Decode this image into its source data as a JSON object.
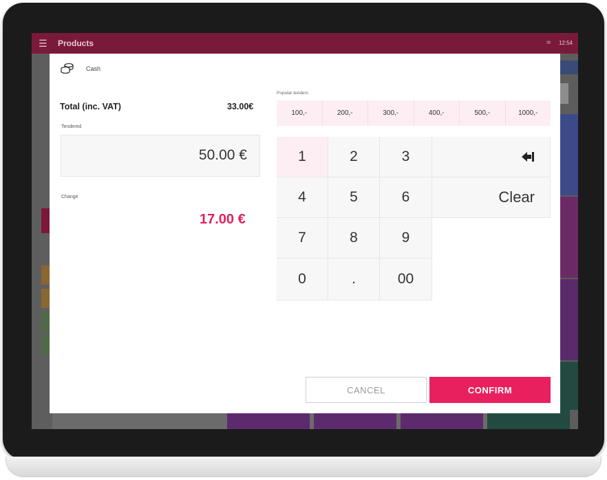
{
  "app": {
    "title": "Products",
    "time": "12:54"
  },
  "modal": {
    "payment_method": "Cash",
    "total_label": "Total (inc. VAT)",
    "total_value": "33.00€",
    "tendered_label": "Tendered",
    "tendered_value": "50.00 €",
    "change_label": "Change",
    "change_value": "17.00 €",
    "popular_label": "Popular tenders",
    "tenders": [
      "100,-",
      "200,-",
      "300,-",
      "400,-",
      "500,-",
      "1000,-"
    ],
    "keypad": {
      "k1": "1",
      "k2": "2",
      "k3": "3",
      "k4": "4",
      "k5": "5",
      "k6": "6",
      "k7": "7",
      "k8": "8",
      "k9": "9",
      "k0": "0",
      "dot": ".",
      "k00": "00",
      "clear": "Clear"
    },
    "cancel_label": "CANCEL",
    "confirm_label": "CONFIRM"
  },
  "colors": {
    "accent": "#e8215e",
    "header": "#7a1a3a",
    "highlight": "#fdeef3"
  }
}
